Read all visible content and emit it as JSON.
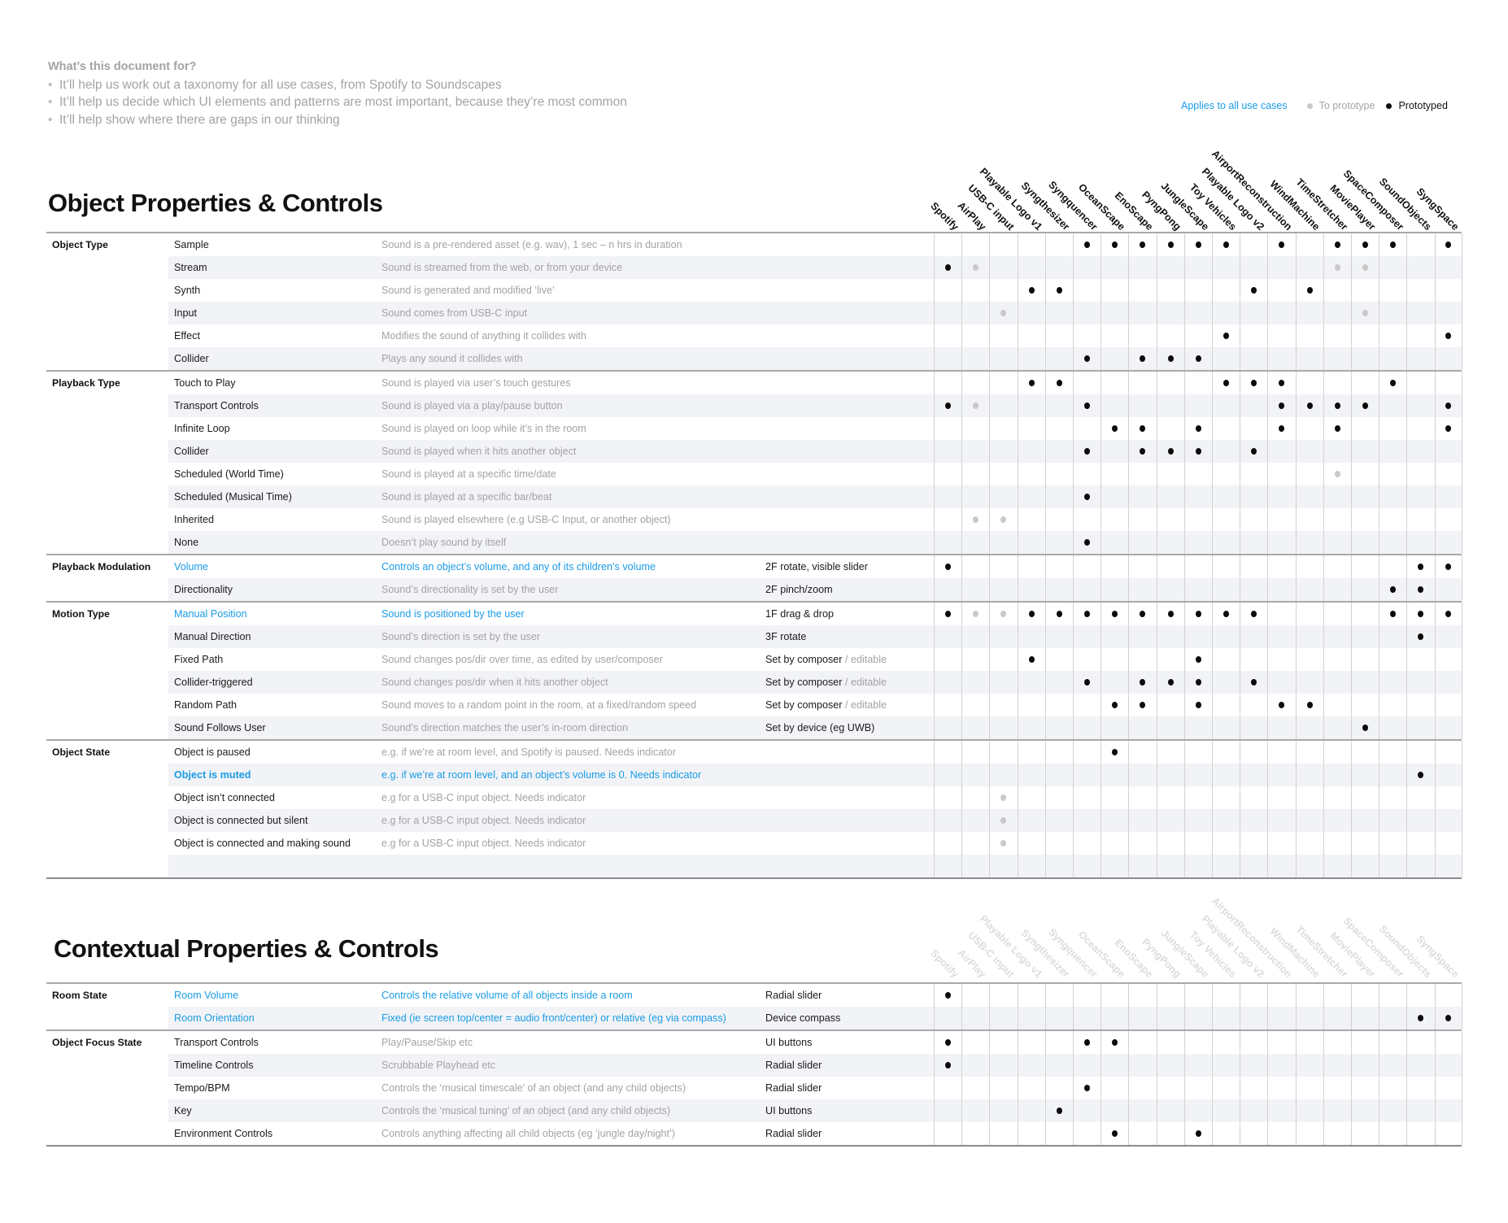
{
  "intro": {
    "heading": "What’s this document for?",
    "bullets": [
      "It’ll help us work out a taxonomy for all use cases, from Spotify to Soundscapes",
      "It’ll help us decide which UI elements and patterns are most important, because they’re most common",
      "It’ll help show where there are gaps in our thinking"
    ]
  },
  "legend": {
    "applies_all": "Applies to all use cases",
    "to_prototype": "To prototype",
    "prototyped": "Prototyped",
    "colors": {
      "blue": "#1a9be6",
      "to_prototype": "#c9c9c9",
      "prototyped": "#0b0b0b"
    }
  },
  "columns": [
    "Spotify",
    "AirPlay",
    "USB-C input",
    "Playable Logo v1",
    "Syngthesizer",
    "Syngquencer",
    "OceanScape",
    "EnoScape",
    "PyngPong",
    "JungleScape",
    "Toy Vehicles",
    "Playable Logo v2",
    "AirportReconstruction",
    "WindMachine",
    "TimeStretcher",
    "MoviePlayer",
    "SpaceComposer",
    "SoundObjects",
    "SyngSpace"
  ],
  "sections": [
    {
      "title": "Object Properties & Controls",
      "groups": [
        {
          "category": "Object Type",
          "rows": [
            {
              "item": "Sample",
              "desc": "Sound is a pre-rendered asset (e.g. wav), 1 sec – n hrs in duration",
              "black": [
                5,
                6,
                7,
                8,
                9,
                10,
                12,
                14,
                15,
                16,
                18
              ],
              "gray": []
            },
            {
              "item": "Stream",
              "desc": "Sound is streamed from the web, or from your device",
              "black": [
                0
              ],
              "gray": [
                1,
                14,
                15
              ]
            },
            {
              "item": "Synth",
              "desc": "Sound is generated and modified ‘live’",
              "black": [
                3,
                4,
                11,
                13
              ],
              "gray": []
            },
            {
              "item": "Input",
              "desc": "Sound comes from USB-C input",
              "black": [],
              "gray": [
                2,
                15
              ]
            },
            {
              "item": "Effect",
              "desc": "Modifies the sound of anything it collides with",
              "black": [
                10,
                18
              ],
              "gray": []
            },
            {
              "item": "Collider",
              "desc": "Plays any sound it collides with",
              "black": [
                5,
                7,
                8,
                9
              ],
              "gray": []
            }
          ]
        },
        {
          "category": "Playback Type",
          "rows": [
            {
              "item": "Touch to Play",
              "desc": "Sound is played via user’s touch gestures",
              "black": [
                3,
                4,
                10,
                11,
                12,
                16
              ],
              "gray": []
            },
            {
              "item": "Transport Controls",
              "desc": "Sound is played via a play/pause button",
              "black": [
                0,
                5,
                12,
                13,
                14,
                15,
                18
              ],
              "gray": [
                1
              ]
            },
            {
              "item": "Infinite Loop",
              "desc": "Sound is played on loop while it’s in the room",
              "black": [
                6,
                7,
                9,
                12,
                14,
                18
              ],
              "gray": []
            },
            {
              "item": "Collider",
              "desc": "Sound is played when it hits another object",
              "black": [
                5,
                7,
                8,
                9,
                11
              ],
              "gray": []
            },
            {
              "item": "Scheduled (World Time)",
              "desc": "Sound is played at a specific time/date",
              "black": [],
              "gray": [
                14
              ]
            },
            {
              "item": "Scheduled (Musical Time)",
              "desc": "Sound is played at a specific bar/beat",
              "black": [
                5
              ],
              "gray": []
            },
            {
              "item": "Inherited",
              "desc": "Sound is played elsewhere (e.g USB-C Input, or another object)",
              "black": [],
              "gray": [
                1,
                2
              ]
            },
            {
              "item": "None",
              "desc": "Doesn’t play sound by itself",
              "black": [
                5
              ],
              "gray": []
            }
          ]
        },
        {
          "category": "Playback Modulation",
          "rows": [
            {
              "item": "Volume",
              "desc": "Controls an object’s volume, and any of its children’s volume",
              "interaction": "2F rotate, visible slider",
              "highlight": true,
              "black": [
                0,
                17,
                18
              ],
              "gray": []
            },
            {
              "item": "Directionality",
              "desc": "Sound’s directionality is set by the user",
              "interaction": "2F pinch/zoom",
              "black": [
                16,
                17
              ],
              "gray": []
            }
          ]
        },
        {
          "category": "Motion Type",
          "rows": [
            {
              "item": "Manual Position",
              "desc": "Sound is positioned by the user",
              "interaction": "1F drag & drop",
              "highlight": true,
              "black": [
                0,
                3,
                4,
                5,
                6,
                7,
                8,
                9,
                10,
                11,
                16,
                17,
                18
              ],
              "gray": [
                1,
                2
              ]
            },
            {
              "item": "Manual Direction",
              "desc": "Sound’s direction is set by the user",
              "interaction": "3F rotate",
              "black": [
                17
              ],
              "gray": []
            },
            {
              "item": "Fixed Path",
              "desc": "Sound changes pos/dir over time, as edited by user/composer",
              "interaction": "Set by composer",
              "interaction_suffix": " / editable",
              "black": [
                3,
                9
              ],
              "gray": []
            },
            {
              "item": "Collider-triggered",
              "desc": "Sound changes pos/dir when it hits another object",
              "interaction": "Set by composer",
              "interaction_suffix": " / editable",
              "black": [
                5,
                7,
                8,
                9,
                11
              ],
              "gray": []
            },
            {
              "item": "Random Path",
              "desc": "Sound moves to a random point in the room, at a fixed/random speed",
              "interaction": "Set by composer",
              "interaction_suffix": " / editable",
              "black": [
                6,
                7,
                9,
                12,
                13
              ],
              "gray": []
            },
            {
              "item": "Sound Follows User",
              "desc": "Sound’s direction matches the user’s in-room direction",
              "interaction": "Set by device (eg UWB)",
              "black": [
                15
              ],
              "gray": []
            }
          ]
        },
        {
          "category": "Object State",
          "rows": [
            {
              "item": "Object is paused",
              "desc": "e.g. if we’re at room level, and Spotify is paused. Needs indicator",
              "black": [
                6
              ],
              "gray": []
            },
            {
              "item": "Object is muted",
              "desc": "e.g. if we’re at room level, and an object’s volume is 0. Needs indicator",
              "highlight": true,
              "bold": true,
              "black": [
                17
              ],
              "gray": []
            },
            {
              "item": "Object isn’t connected",
              "desc": "e.g for a USB-C input object. Needs indicator",
              "black": [],
              "gray": [
                2
              ]
            },
            {
              "item": "Object is connected but silent",
              "desc": "e.g for a USB-C input object. Needs indicator",
              "black": [],
              "gray": [
                2
              ]
            },
            {
              "item": "Object is connected and making sound",
              "desc": "e.g for a USB-C input object. Needs indicator",
              "black": [],
              "gray": [
                2
              ]
            },
            {
              "item": "",
              "desc": "",
              "black": [],
              "gray": []
            }
          ]
        }
      ]
    },
    {
      "title": "Contextual Properties & Controls",
      "groups": [
        {
          "category": "Room State",
          "rows": [
            {
              "item": "Room Volume",
              "desc": "Controls the relative volume of all objects inside a room",
              "interaction": "Radial slider",
              "highlight": true,
              "black": [
                0
              ],
              "gray": []
            },
            {
              "item": "Room Orientation",
              "desc": "Fixed (ie screen top/center = audio front/center) or relative (eg via compass)",
              "interaction": "Device compass",
              "highlight": true,
              "black": [
                17,
                18
              ],
              "gray": []
            }
          ]
        },
        {
          "category": "Object Focus State",
          "rows": [
            {
              "item": "Transport Controls",
              "desc": "Play/Pause/Skip etc",
              "interaction": "UI buttons",
              "black": [
                0,
                5,
                6
              ],
              "gray": []
            },
            {
              "item": "Timeline Controls",
              "desc": "Scrubbable Playhead etc",
              "interaction": "Radial slider",
              "black": [
                0
              ],
              "gray": []
            },
            {
              "item": "Tempo/BPM",
              "desc": "Controls the ‘musical timescale’ of an object (and any child objects)",
              "interaction": "Radial slider",
              "black": [
                5
              ],
              "gray": []
            },
            {
              "item": "Key",
              "desc": "Controls the ‘musical tuning’ of an object (and any child objects)",
              "interaction": "UI buttons",
              "black": [
                4
              ],
              "gray": []
            },
            {
              "item": "Environment Controls",
              "desc": "Controls anything affecting all child objects (eg ‘jungle day/night’)",
              "interaction": "Radial slider",
              "black": [
                6,
                9
              ],
              "gray": []
            }
          ]
        }
      ]
    }
  ]
}
